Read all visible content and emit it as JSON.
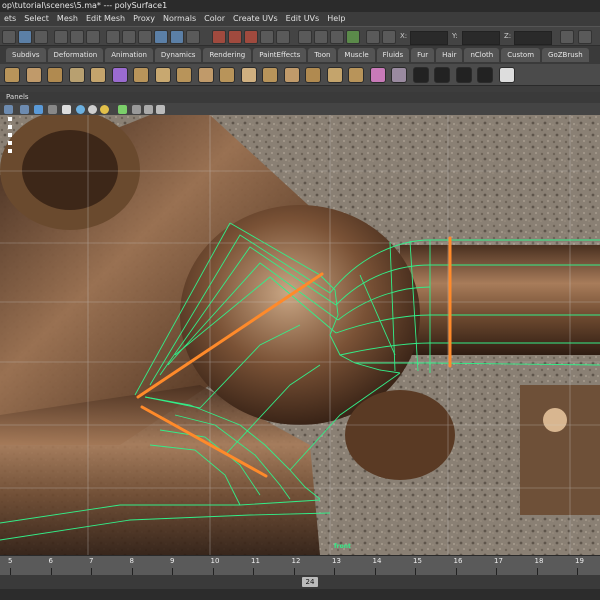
{
  "window": {
    "title": "op\\tutorial\\scenes\\5.ma*  ---  polySurface1"
  },
  "menus": [
    "ets",
    "Select",
    "Mesh",
    "Edit Mesh",
    "Proxy",
    "Normals",
    "Color",
    "Create UVs",
    "Edit UVs",
    "Help"
  ],
  "status_line": {
    "field_labels": [
      "X:",
      "Y:",
      "Z:"
    ]
  },
  "shelf_tabs": [
    {
      "label": "Subdivs",
      "active": false
    },
    {
      "label": "Deformation",
      "active": false
    },
    {
      "label": "Animation",
      "active": false
    },
    {
      "label": "Dynamics",
      "active": false
    },
    {
      "label": "Rendering",
      "active": false
    },
    {
      "label": "PaintEffects",
      "active": false
    },
    {
      "label": "Toon",
      "active": false
    },
    {
      "label": "Muscle",
      "active": false
    },
    {
      "label": "Fluids",
      "active": false
    },
    {
      "label": "Fur",
      "active": false
    },
    {
      "label": "Hair",
      "active": false
    },
    {
      "label": "nCloth",
      "active": false
    },
    {
      "label": "Custom",
      "active": false
    },
    {
      "label": "GoZBrush",
      "active": false
    }
  ],
  "shelf_icons": [
    "poly-cylinder-icon",
    "poly-sphere-icon",
    "poly-torus-icon",
    "poly-ring-icon",
    "poly-gear-icon",
    "poly-cube-icon",
    "poly-bevel-icon",
    "poly-plane-icon",
    "poly-combine-icon",
    "poly-bridge-icon",
    "poly-wedge-icon",
    "poly-extrude-icon",
    "poly-split-icon",
    "poly-fill-icon",
    "poly-merge-icon",
    "poly-append-icon",
    "poly-collapse-icon",
    "poly-cone-icon",
    "uv-layout-icon",
    "checker-uv-icon",
    "checker-planar-icon",
    "checker-cylindrical-icon",
    "checker-spherical-icon",
    "checker-auto-icon"
  ],
  "panel": {
    "menu_label": "Panels",
    "camera_label": "front"
  },
  "timeline": {
    "tick_labels": [
      "5",
      "6",
      "7",
      "8",
      "9",
      "10",
      "11",
      "12",
      "13",
      "14",
      "15",
      "16",
      "17",
      "18",
      "19"
    ],
    "current_frame": "24"
  },
  "colors": {
    "wireframe": "#33ee88",
    "edge_highlight": "#ff8a2a",
    "ui_dark": "#3c3c3c"
  }
}
